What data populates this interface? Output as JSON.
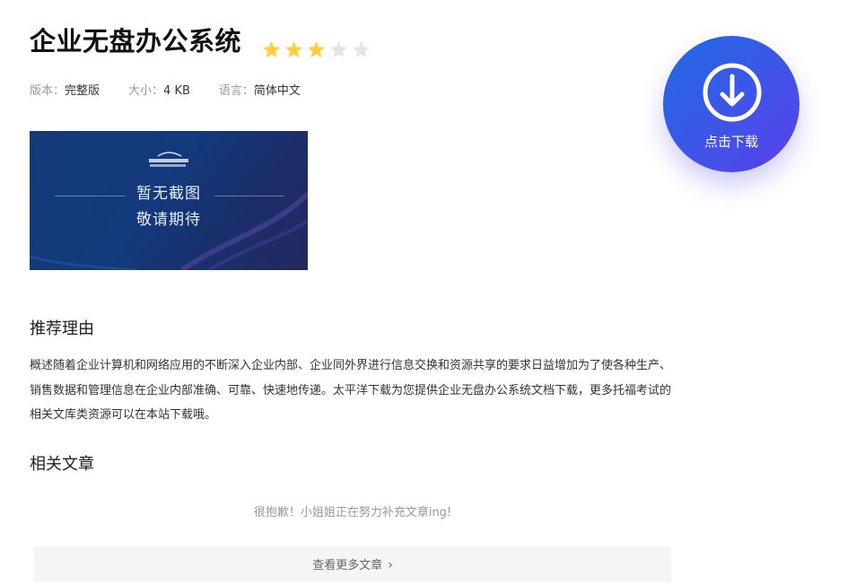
{
  "page": {
    "title": "企业无盘办公系统",
    "rating": {
      "value": 3,
      "max": 5,
      "filled_color": "#ffd043",
      "empty_color": "#e5e5e5"
    }
  },
  "meta": {
    "version_label": "版本：",
    "version_value": "完整版",
    "size_label": "大小：",
    "size_value": "4 KB",
    "language_label": "语言：",
    "language_value": "简体中文"
  },
  "screenshot": {
    "line1": "暂无截图",
    "line2": "敬请期待",
    "logo_icon": "pconline-logo"
  },
  "download": {
    "label": "点击下载",
    "icon": "download-arrow-icon",
    "accent": "#3f54e9"
  },
  "recommend": {
    "heading": "推荐理由",
    "text": "概述随着企业计算机和网络应用的不断深入企业内部、企业同外界进行信息交换和资源共享的要求日益增加为了使各种生产、销售数据和管理信息在企业内部准确、可靠、快速地传递。太平洋下载为您提供企业无盘办公系统文档下载，更多托福考试的相关文库类资源可以在本站下载哦。"
  },
  "related": {
    "heading": "相关文章",
    "empty_text": "很抱歉！小姐姐正在努力补充文章ing!",
    "more_label": "查看更多文章",
    "more_icon": "chevron-right-icon"
  }
}
